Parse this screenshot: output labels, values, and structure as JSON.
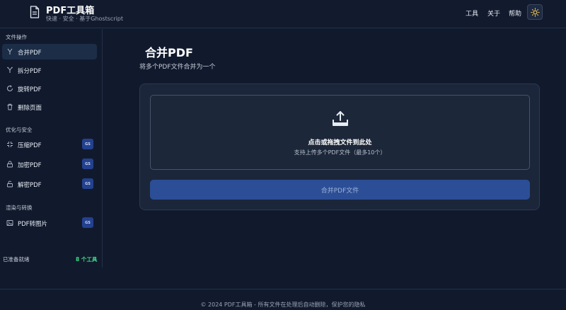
{
  "header": {
    "title": "PDF工具箱",
    "subtitle": "快速 · 安全 · 基于Ghostscript",
    "nav": [
      {
        "label": "工具"
      },
      {
        "label": "关于"
      },
      {
        "label": "帮助"
      }
    ],
    "theme_icon": "sun-icon"
  },
  "sidebar": {
    "sections": [
      {
        "label": "文件操作"
      },
      {
        "label": "优化与安全"
      },
      {
        "label": "渲染与转换"
      }
    ],
    "items": [
      {
        "label": "合并PDF",
        "icon": "merge-icon",
        "active": true
      },
      {
        "label": "拆分PDF",
        "icon": "split-icon"
      },
      {
        "label": "旋转PDF",
        "icon": "rotate-icon"
      },
      {
        "label": "删除页面",
        "icon": "trash-icon"
      },
      {
        "label": "压缩PDF",
        "icon": "compress-icon",
        "badge": "GS"
      },
      {
        "label": "加密PDF",
        "icon": "lock-icon",
        "badge": "GS"
      },
      {
        "label": "解密PDF",
        "icon": "unlock-icon",
        "badge": "GS"
      },
      {
        "label": "PDF转图片",
        "icon": "image-icon",
        "badge": "GS"
      }
    ],
    "status": "已准备就绪",
    "tool_count": "8 个工具"
  },
  "main": {
    "title": "合并PDF",
    "description": "将多个PDF文件合并为一个",
    "dropzone": {
      "title": "点击或拖拽文件到此处",
      "subtitle": "支持上传多个PDF文件（最多10个）",
      "icon": "upload-icon"
    },
    "button_label": "合并PDF文件"
  },
  "footer": {
    "text": "© 2024 PDF工具箱 - 所有文件在处理后自动删除，保护您的隐私"
  },
  "colors": {
    "background": "#111a2d",
    "accent": "#2b4e97",
    "status_green": "#3ddc84",
    "badge": "#23418f"
  }
}
